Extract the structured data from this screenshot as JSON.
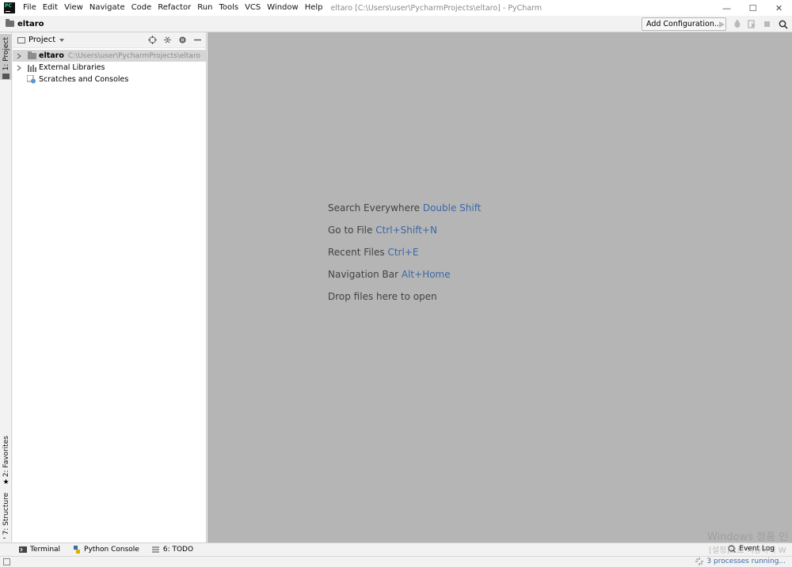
{
  "titlebar": {
    "menu": [
      {
        "id": "file",
        "label": "File"
      },
      {
        "id": "edit",
        "label": "Edit"
      },
      {
        "id": "view",
        "label": "View"
      },
      {
        "id": "navigate",
        "label": "Navigate"
      },
      {
        "id": "code",
        "label": "Code"
      },
      {
        "id": "refactor",
        "label": "Refactor"
      },
      {
        "id": "run",
        "label": "Run"
      },
      {
        "id": "tools",
        "label": "Tools"
      },
      {
        "id": "vcs",
        "label": "VCS"
      },
      {
        "id": "window",
        "label": "Window"
      },
      {
        "id": "help",
        "label": "Help"
      }
    ],
    "window_title": "eltaro [C:\\Users\\user\\PycharmProjects\\eltaro] - PyCharm",
    "minimize": "—",
    "maximize": "☐",
    "close": "✕"
  },
  "navbar": {
    "breadcrumb": "eltaro",
    "add_configuration": "Add Configuration...",
    "icons": [
      "run-icon",
      "debug-icon",
      "coverage-icon",
      "stop-icon",
      "search-icon"
    ]
  },
  "left_strip": {
    "project_tab": "1: Project",
    "favorites_tab": "2: Favorites",
    "structure_tab": "7: Structure"
  },
  "project_panel": {
    "title": "Project",
    "tree": [
      {
        "label": "eltaro",
        "path": "C:\\Users\\user\\PycharmProjects\\eltaro",
        "icon": "folder-icon",
        "expandable": true,
        "selected": true
      },
      {
        "label": "External Libraries",
        "icon": "library-icon",
        "expandable": true
      },
      {
        "label": "Scratches and Consoles",
        "icon": "scratches-icon",
        "expandable": false
      }
    ]
  },
  "editor": {
    "hints": [
      {
        "text": "Search Everywhere",
        "key": "Double Shift"
      },
      {
        "text": "Go to File",
        "key": "Ctrl+Shift+N"
      },
      {
        "text": "Recent Files",
        "key": "Ctrl+E"
      },
      {
        "text": "Navigation Bar",
        "key": "Alt+Home"
      },
      {
        "text": "Drop files here to open",
        "key": ""
      }
    ]
  },
  "bottom_tabs": {
    "terminal": "Terminal",
    "python_console": "Python Console",
    "todo": "6: TODO",
    "event_log": "Event Log"
  },
  "status": {
    "processes": "3 processes running..."
  },
  "watermark": {
    "line1": "Windows 정품 인",
    "line2": "[설정]으로 이동하여 W"
  },
  "colors": {
    "editor_bg": "#b5b5b5",
    "hint_key": "#3d67a8",
    "link_blue": "#3d67a8"
  }
}
